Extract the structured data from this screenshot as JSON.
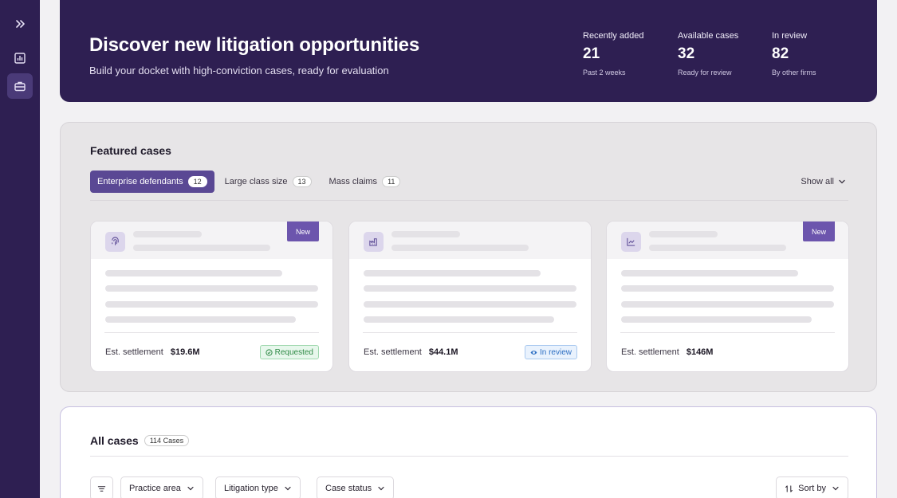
{
  "hero": {
    "title": "Discover new litigation opportunities",
    "subtitle": "Build your docket with high-conviction cases, ready for evaluation",
    "stats": [
      {
        "label": "Recently added",
        "value": "21",
        "sub": "Past 2 weeks"
      },
      {
        "label": "Available cases",
        "value": "32",
        "sub": "Ready for review"
      },
      {
        "label": "In review",
        "value": "82",
        "sub": "By other firms"
      }
    ]
  },
  "featured": {
    "title": "Featured cases",
    "tabs": [
      {
        "label": "Enterprise defendants",
        "count": "12",
        "active": true
      },
      {
        "label": "Large class size",
        "count": "13",
        "active": false
      },
      {
        "label": "Mass claims",
        "count": "11",
        "active": false
      }
    ],
    "show_all": "Show all",
    "cards": [
      {
        "icon": "fingerprint-icon",
        "badge": "New",
        "settle_label": "Est. settlement",
        "settle_value": "$19.6M",
        "status": "Requested",
        "status_kind": "green"
      },
      {
        "icon": "factory-icon",
        "badge": "",
        "settle_label": "Est. settlement",
        "settle_value": "$44.1M",
        "status": "In review",
        "status_kind": "blue"
      },
      {
        "icon": "chart-icon",
        "badge": "New",
        "settle_label": "Est. settlement",
        "settle_value": "$146M",
        "status": "",
        "status_kind": ""
      }
    ]
  },
  "all_cases": {
    "title": "All cases",
    "count": "114 Cases",
    "filters": [
      "Practice area",
      "Litigation type",
      "Case status"
    ],
    "sort_label": "Sort by"
  },
  "colors": {
    "brand": "#2e1f52",
    "accent": "#5a4894",
    "badge": "#6c55ad"
  }
}
